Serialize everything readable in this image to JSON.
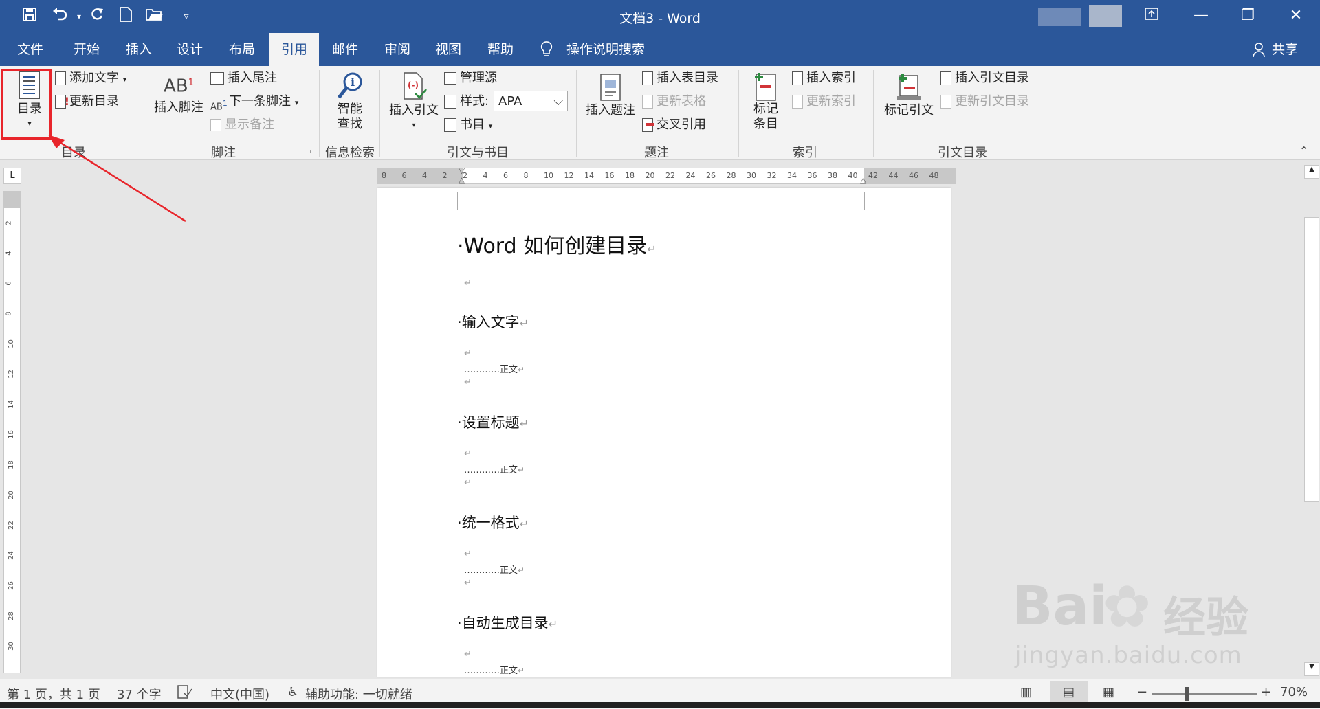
{
  "window": {
    "title": "文档3  -  Word",
    "share_label": "共享",
    "colors": {
      "brand": "#2b579a",
      "highlight": "#e8252b"
    }
  },
  "qat": {
    "icons": [
      "save-icon",
      "undo-icon",
      "redo-icon",
      "new-document-icon",
      "open-folder-icon",
      "customize-qat-icon"
    ]
  },
  "tabs": [
    "文件",
    "开始",
    "插入",
    "设计",
    "布局",
    "引用",
    "邮件",
    "审阅",
    "视图",
    "帮助"
  ],
  "active_tab": "引用",
  "tellme": "操作说明搜索",
  "ribbon": {
    "toc": {
      "button": "目录",
      "add_text": "添加文字",
      "update": "更新目录",
      "group": "目录"
    },
    "footnotes": {
      "insert_footnote": "插入脚注",
      "insert_endnote": "插入尾注",
      "next_footnote": "下一条脚注",
      "show_notes": "显示备注",
      "group": "脚注"
    },
    "research": {
      "smart_lookup_1": "智能",
      "smart_lookup_2": "查找",
      "group": "信息检索"
    },
    "citations": {
      "insert_citation": "插入引文",
      "manage_sources": "管理源",
      "style_label": "样式:",
      "style_value": "APA",
      "bibliography": "书目",
      "group": "引文与书目"
    },
    "captions": {
      "insert_caption": "插入题注",
      "insert_table_of_figures": "插入表目录",
      "update_table": "更新表格",
      "cross_reference": "交叉引用",
      "group": "题注"
    },
    "index": {
      "mark_entry_1": "标记",
      "mark_entry_2": "条目",
      "insert_index": "插入索引",
      "update_index": "更新索引",
      "group": "索引"
    },
    "authorities": {
      "mark_citation": "标记引文",
      "insert_table": "插入引文目录",
      "update_table": "更新引文目录",
      "group": "引文目录"
    }
  },
  "ruler": {
    "ticks": [
      "8",
      "6",
      "4",
      "2",
      "2",
      "4",
      "6",
      "8",
      "10",
      "12",
      "14",
      "16",
      "18",
      "20",
      "22",
      "24",
      "26",
      "28",
      "30",
      "32",
      "34",
      "36",
      "38",
      "40",
      "42",
      "44",
      "46",
      "48"
    ],
    "vticks": [
      "2",
      "4",
      "6",
      "8",
      "10",
      "12",
      "14",
      "16",
      "18",
      "20",
      "22",
      "24",
      "26",
      "28",
      "30"
    ]
  },
  "document": {
    "title": "Word 如何创建目录",
    "headings": [
      "输入文字",
      "设置标题",
      "统一格式",
      "自动生成目录"
    ],
    "body": "…………正文"
  },
  "status": {
    "page": "第 1 页，共 1 页",
    "words": "37 个字",
    "language": "中文(中国)",
    "accessibility": "辅助功能: 一切就绪",
    "zoom": "70%",
    "zoom_level": 0.7
  },
  "watermark": {
    "brand": "Bai",
    "brand2": "经验",
    "url": "jingyan.baidu.com"
  }
}
